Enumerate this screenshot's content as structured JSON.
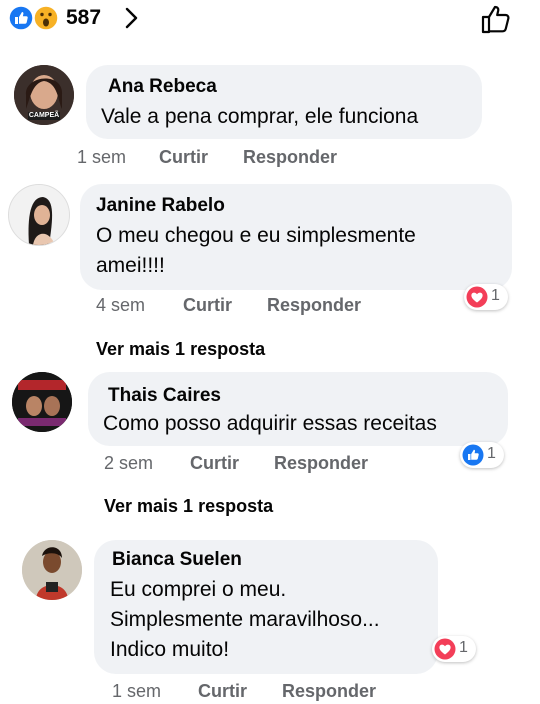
{
  "header": {
    "reaction_icons": [
      "like-icon",
      "wow-icon"
    ],
    "reaction_count": "587",
    "chevron_icon": "chevron-right-icon",
    "like_button_icon": "thumbs-up-outline-icon"
  },
  "colors": {
    "bubble": "#f0f2f5",
    "meta_text": "#65676b",
    "like_blue": "#1877f2",
    "love_red": "#f33e58"
  },
  "comments": [
    {
      "author": "Ana Rebeca",
      "avatar_badge": "CAMPEÃ",
      "text": "Vale a pena comprar, ele funciona",
      "time": "1 sem",
      "like_label": "Curtir",
      "reply_label": "Responder"
    },
    {
      "author": "Janine Rabelo",
      "text": "O meu chegou e eu simplesmente\namei!!!!",
      "time": "4 sem",
      "like_label": "Curtir",
      "reply_label": "Responder",
      "reaction": {
        "icon": "love-icon",
        "count": "1"
      },
      "more_replies": "Ver mais 1 resposta"
    },
    {
      "author": "Thais Caires",
      "text": "Como posso adquirir essas receitas",
      "time": "2 sem",
      "like_label": "Curtir",
      "reply_label": "Responder",
      "reaction": {
        "icon": "like-icon",
        "count": "1"
      },
      "more_replies": "Ver mais 1 resposta"
    },
    {
      "author": "Bianca Suelen",
      "text": "Eu comprei o meu.\nSimplesmente maravilhoso...\nIndico muito!",
      "time": "1 sem",
      "like_label": "Curtir",
      "reply_label": "Responder",
      "reaction": {
        "icon": "love-icon",
        "count": "1"
      }
    }
  ]
}
